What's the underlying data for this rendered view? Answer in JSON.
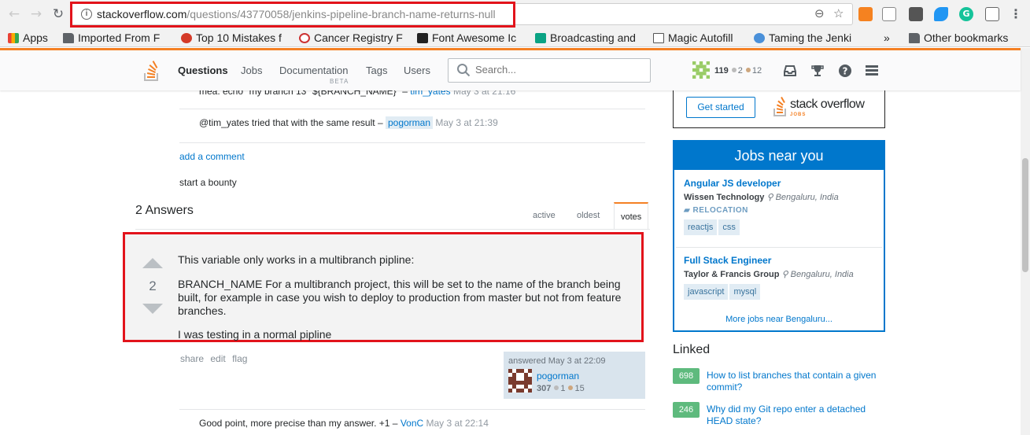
{
  "browser": {
    "url_host": "stackoverflow.com",
    "url_path": "/questions/43770058/jenkins-pipeline-branch-name-returns-null",
    "back_glyph": "←",
    "forward_glyph": "→",
    "reload_glyph": "↻",
    "info_glyph": "i",
    "zoom_glyph": "⊖",
    "star_glyph": "☆",
    "ext_google_glyph": "G",
    "bookmarks": [
      {
        "label": "Apps"
      },
      {
        "label": "Imported From F"
      },
      {
        "label": "Top 10 Mistakes f"
      },
      {
        "label": "Cancer Registry F"
      },
      {
        "label": "Font Awesome Ic"
      },
      {
        "label": "Broadcasting and"
      },
      {
        "label": "Magic Autofill"
      },
      {
        "label": "Taming the Jenki"
      }
    ],
    "more_bookmarks": "»",
    "other_bookmarks": "Other bookmarks"
  },
  "topbar": {
    "nav": [
      "Questions",
      "Jobs",
      "Documentation",
      "Tags",
      "Users"
    ],
    "beta_label": "BETA",
    "search_placeholder": "Search...",
    "reputation": "119",
    "silver_badges": "2",
    "bronze_badges": "12"
  },
  "comments_top": {
    "partial_text": "mea: echo \"my branch 13\" ${BRANCH_NAME}\" –",
    "partial_user": "tim_yates",
    "partial_date": "May 3 at 21:16",
    "text": "@tim_yates tried that with the same result –",
    "user": "pogorman",
    "date": "May 3 at 21:39"
  },
  "add_comment": "add a comment",
  "start_bounty": "start a bounty",
  "answers": {
    "header": "2 Answers",
    "sort_tabs": [
      "active",
      "oldest",
      "votes"
    ],
    "vote_count": "2",
    "paragraphs": [
      "This variable only works in a multibranch pipline:",
      "BRANCH_NAME For a multibranch project, this will be set to the name of the branch being built, for example in case you wish to deploy to production from master but not from feature branches.",
      "I was testing in a normal pipline"
    ],
    "post_menu": [
      "share",
      "edit",
      "flag"
    ],
    "answered_time": "answered May 3 at 22:09",
    "user": "pogorman",
    "user_rep": "307",
    "user_silver": "1",
    "user_bronze": "15",
    "comment_text": "Good point, more precise than my answer. +1 –",
    "comment_user": "VonC",
    "comment_date": "May 3 at 22:14"
  },
  "sidebar": {
    "ad_button": "Get started",
    "ad_logo_text": "stack overflow",
    "ad_logo_sub": "JOBS",
    "jobs_header": "Jobs near you",
    "jobs": [
      {
        "title": "Angular JS developer",
        "company": "Wissen Technology",
        "location": "Bengaluru, India",
        "relocation": "RELOCATION",
        "tags": [
          "reactjs",
          "css"
        ]
      },
      {
        "title": "Full Stack Engineer",
        "company": "Taylor & Francis Group",
        "location": "Bengaluru, India",
        "tags": [
          "javascript",
          "mysql"
        ]
      }
    ],
    "more_jobs": "More jobs near Bengaluru...",
    "linked_header": "Linked",
    "linked": [
      {
        "count": "698",
        "title": "How to list branches that contain a given commit?"
      },
      {
        "count": "246",
        "title": "Why did my Git repo enter a detached HEAD state?"
      }
    ]
  },
  "colors": {
    "accent": "#f48024",
    "link": "#0077cc",
    "highlight": "#e2131b",
    "accepted_green": "#5eba7d"
  }
}
